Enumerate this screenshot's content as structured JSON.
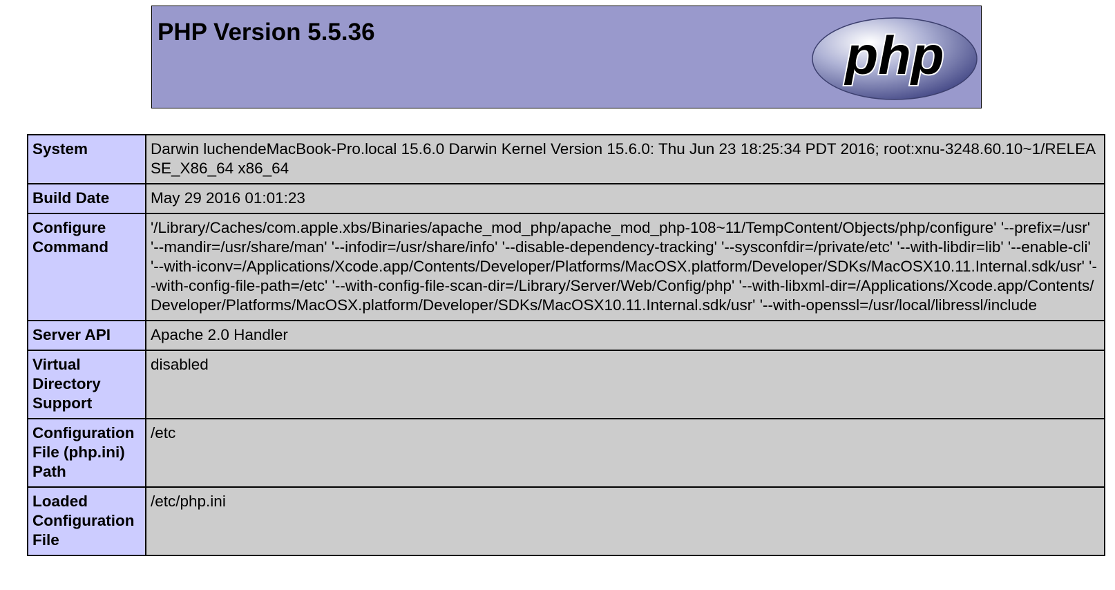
{
  "header": {
    "title": "PHP Version 5.5.36",
    "logo_text": "php",
    "background": "#9999cc"
  },
  "colors": {
    "key_cell": "#ccccff",
    "value_cell": "#cccccc"
  },
  "rows": [
    {
      "key": "System",
      "value": "Darwin luchendeMacBook-Pro.local 15.6.0 Darwin Kernel Version 15.6.0: Thu Jun 23 18:25:34 PDT 2016; root:xnu-3248.60.10~1/RELEASE_X86_64 x86_64"
    },
    {
      "key": "Build Date",
      "value": "May 29 2016 01:01:23"
    },
    {
      "key": "Configure Command",
      "value": "'/Library/Caches/com.apple.xbs/Binaries/apache_mod_php/apache_mod_php-108~11/TempContent/Objects/php/configure' '--prefix=/usr' '--mandir=/usr/share/man' '--infodir=/usr/share/info' '--disable-dependency-tracking' '--sysconfdir=/private/etc' '--with-libdir=lib' '--enable-cli' '--with-iconv=/Applications/Xcode.app/Contents/Developer/Platforms/MacOSX.platform/Developer/SDKs/MacOSX10.11.Internal.sdk/usr' '--with-config-file-path=/etc' '--with-config-file-scan-dir=/Library/Server/Web/Config/php' '--with-libxml-dir=/Applications/Xcode.app/Contents/Developer/Platforms/MacOSX.platform/Developer/SDKs/MacOSX10.11.Internal.sdk/usr' '--with-openssl=/usr/local/libressl/include"
    },
    {
      "key": "Server API",
      "value": "Apache 2.0 Handler"
    },
    {
      "key": "Virtual Directory Support",
      "value": "disabled"
    },
    {
      "key": "Configuration File (php.ini) Path",
      "value": "/etc"
    },
    {
      "key": "Loaded Configuration File",
      "value": "/etc/php.ini"
    }
  ]
}
